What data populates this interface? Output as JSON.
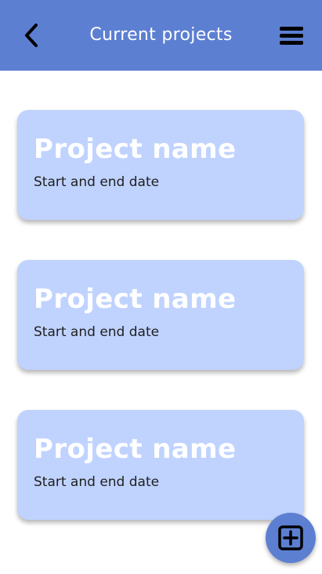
{
  "header": {
    "title": "Current projects",
    "back_icon": "chevron-left-icon",
    "menu_icon": "hamburger-menu-icon"
  },
  "projects": [
    {
      "name": "Project name",
      "dates": "Start and end date"
    },
    {
      "name": "Project name",
      "dates": "Start and end date"
    },
    {
      "name": "Project name",
      "dates": "Start and end date"
    }
  ],
  "fab": {
    "icon": "add-box-icon"
  },
  "colors": {
    "header_bg": "#5c7fd2",
    "card_bg": "#c0d3ff",
    "fab_bg": "#5c7fd2",
    "card_title": "#ffffff",
    "card_subtitle": "#1f1f1f"
  }
}
